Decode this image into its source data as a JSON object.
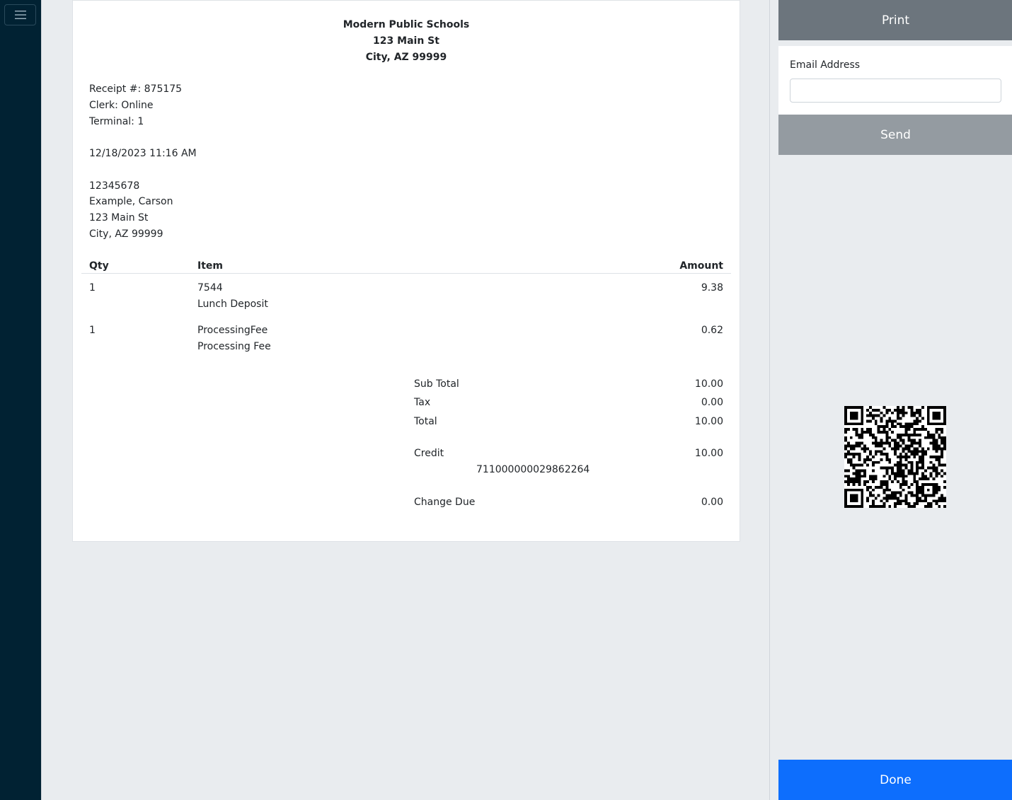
{
  "receipt": {
    "org_name": "Modern Public Schools",
    "org_address1": "123 Main St",
    "org_address2": "City, AZ 99999",
    "receipt_no": "Receipt #: 875175",
    "clerk": "Clerk: Online",
    "terminal": "Terminal: 1",
    "datetime": "12/18/2023 11:16 AM",
    "customer": {
      "id": "12345678",
      "name": "Example, Carson",
      "address1": "123 Main St",
      "address2": "City, AZ 99999"
    },
    "columns": {
      "qty": "Qty",
      "item": "Item",
      "amount": "Amount"
    },
    "items": [
      {
        "qty": "1",
        "code": "7544",
        "desc": "Lunch Deposit",
        "amount": "9.38"
      },
      {
        "qty": "1",
        "code": "ProcessingFee",
        "desc": "Processing Fee",
        "amount": "0.62"
      }
    ],
    "totals": {
      "subtotal_label": "Sub Total",
      "subtotal": "10.00",
      "tax_label": "Tax",
      "tax": "0.00",
      "total_label": "Total",
      "total": "10.00",
      "credit_label": "Credit",
      "credit": "10.00",
      "credit_ref": "711000000029862264",
      "change_label": "Change Due",
      "change": "0.00"
    }
  },
  "panel": {
    "print_label": "Print",
    "email_label": "Email Address",
    "email_value": "",
    "email_placeholder": "",
    "send_label": "Send",
    "done_label": "Done"
  },
  "colors": {
    "sidebar": "#012233",
    "print_button": "#6c757d",
    "send_button": "#949ba1",
    "done_button": "#0d6efd",
    "background": "#e9ecef"
  },
  "icons": {
    "menu": "hamburger-menu-icon",
    "qr": "qr-code-image"
  }
}
